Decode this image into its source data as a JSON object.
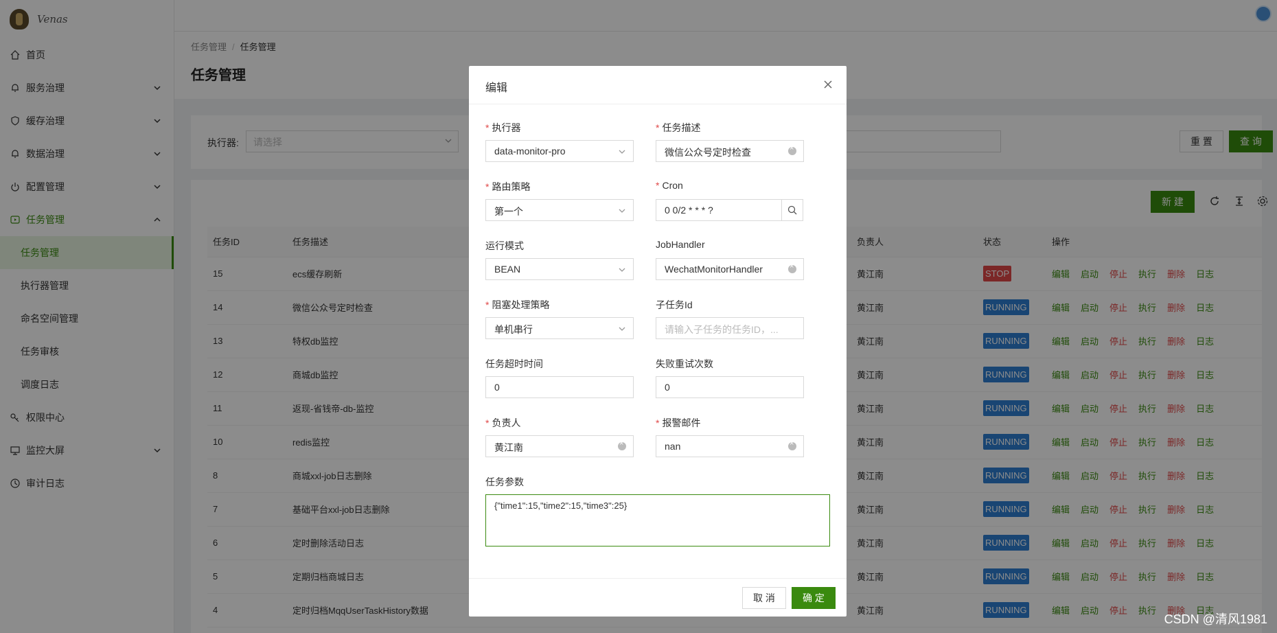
{
  "app": {
    "name": "Venas"
  },
  "sidebar": {
    "items": [
      {
        "label": "首页",
        "icon": "home-icon"
      },
      {
        "label": "服务治理",
        "icon": "bell-icon"
      },
      {
        "label": "缓存治理",
        "icon": "shield-icon"
      },
      {
        "label": "数据治理",
        "icon": "bell-icon"
      },
      {
        "label": "配置管理",
        "icon": "power-icon"
      },
      {
        "label": "任务管理",
        "icon": "play-icon"
      }
    ],
    "sub_items": [
      {
        "label": "任务管理"
      },
      {
        "label": "执行器管理"
      },
      {
        "label": "命名空间管理"
      },
      {
        "label": "任务审核"
      },
      {
        "label": "调度日志"
      }
    ],
    "bottom_items": [
      {
        "label": "权限中心",
        "icon": "key-icon"
      },
      {
        "label": "监控大屏",
        "icon": "monitor-icon"
      },
      {
        "label": "审计日志",
        "icon": "clock-icon"
      }
    ]
  },
  "breadcrumb": {
    "parent": "任务管理",
    "separator": "/",
    "current": "任务管理"
  },
  "page": {
    "title": "任务管理"
  },
  "search": {
    "executor_label": "执行器:",
    "executor_placeholder": "请选择",
    "reset_label": "重 置",
    "query_label": "查 询"
  },
  "table": {
    "new_label": "新 建",
    "headers": {
      "id": "任务ID",
      "desc": "任务描述",
      "owner": "负责人",
      "status": "状态",
      "ops": "操作"
    },
    "ops": [
      "编辑",
      "启动",
      "停止",
      "执行",
      "删除",
      "日志"
    ],
    "rows": [
      {
        "id": "15",
        "desc": "ecs缓存刷新",
        "owner": "黄江南",
        "status": "STOP"
      },
      {
        "id": "14",
        "desc": "微信公众号定时检查",
        "owner": "黄江南",
        "status": "RUNNING"
      },
      {
        "id": "13",
        "desc": "特权db监控",
        "owner": "黄江南",
        "status": "RUNNING"
      },
      {
        "id": "12",
        "desc": "商城db监控",
        "owner": "黄江南",
        "status": "RUNNING"
      },
      {
        "id": "11",
        "desc": "返现-省钱帝-db-监控",
        "owner": "黄江南",
        "status": "RUNNING"
      },
      {
        "id": "10",
        "desc": "redis监控",
        "owner": "黄江南",
        "status": "RUNNING"
      },
      {
        "id": "8",
        "desc": "商城xxl-job日志删除",
        "owner": "黄江南",
        "status": "RUNNING"
      },
      {
        "id": "7",
        "desc": "基础平台xxl-job日志删除",
        "owner": "黄江南",
        "status": "RUNNING"
      },
      {
        "id": "6",
        "desc": "定时删除活动日志",
        "owner": "黄江南",
        "status": "RUNNING"
      },
      {
        "id": "5",
        "desc": "定期归档商城日志",
        "owner": "黄江南",
        "status": "RUNNING"
      },
      {
        "id": "4",
        "desc": "定时归档MqqUserTaskHistory数据",
        "owner": "黄江南",
        "status": "RUNNING"
      }
    ]
  },
  "modal": {
    "title": "编辑",
    "fields": {
      "executor": {
        "label": "执行器",
        "value": "data-monitor-pro"
      },
      "task_desc": {
        "label": "任务描述",
        "value": "微信公众号定时检查"
      },
      "route": {
        "label": "路由策略",
        "value": "第一个"
      },
      "cron": {
        "label": "Cron",
        "value": "0 0/2 * * * ?"
      },
      "run_mode": {
        "label": "运行模式",
        "value": "BEAN"
      },
      "job_handler": {
        "label": "JobHandler",
        "value": "WechatMonitorHandler"
      },
      "block": {
        "label": "阻塞处理策略",
        "value": "单机串行"
      },
      "child_id": {
        "label": "子任务Id",
        "placeholder": "请输入子任务的任务ID，..."
      },
      "timeout": {
        "label": "任务超时时间",
        "value": "0"
      },
      "retry": {
        "label": "失败重试次数",
        "value": "0"
      },
      "owner": {
        "label": "负责人",
        "value": "黄江南"
      },
      "alarm_email": {
        "label": "报警邮件",
        "value": "nan"
      },
      "params": {
        "label": "任务参数",
        "value": "{\"time1\":15,\"time2\":15,\"time3\":25}"
      }
    },
    "cancel_label": "取 消",
    "ok_label": "确 定"
  },
  "watermark": {
    "text": "CSDN @清风1981"
  },
  "colors": {
    "primary": "#3a8a0f",
    "danger": "#e04848",
    "running": "#2f7fd1"
  }
}
